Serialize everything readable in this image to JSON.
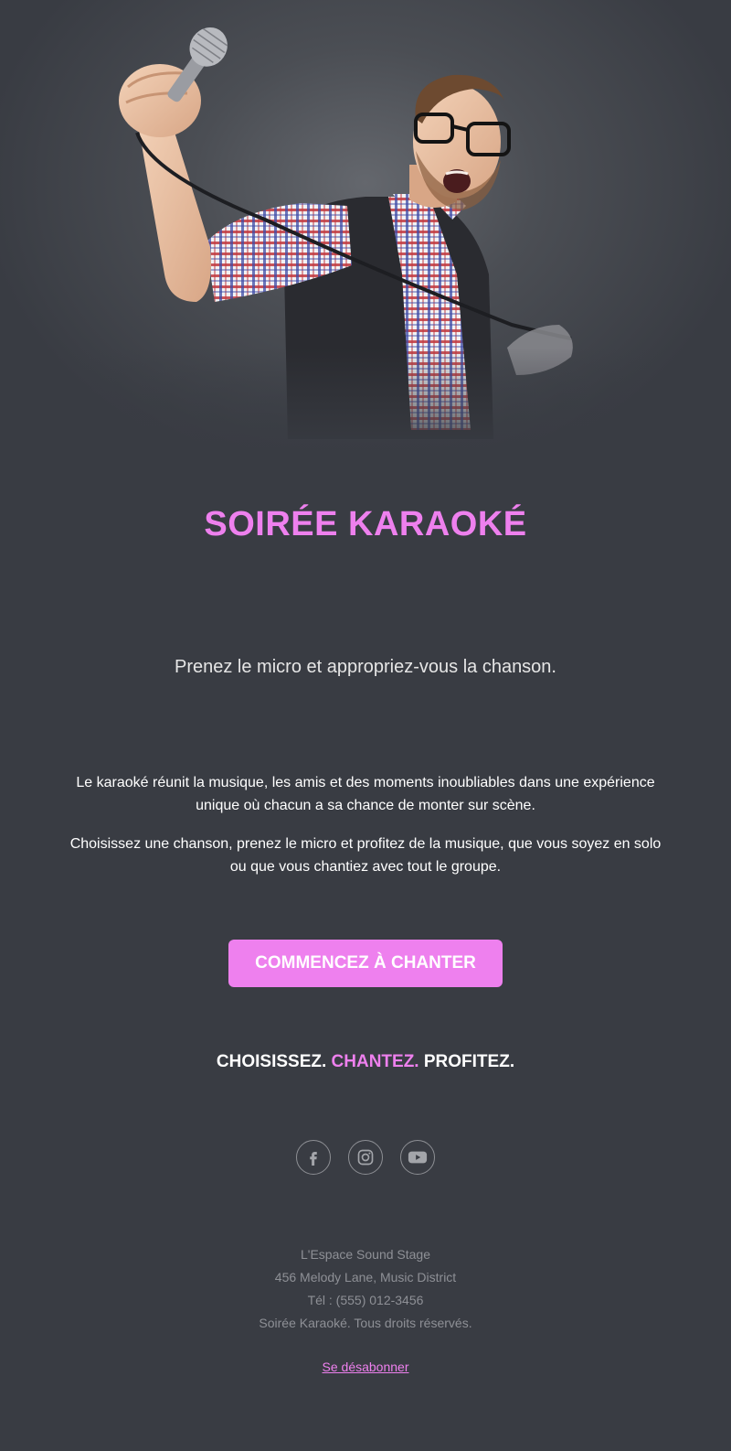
{
  "colors": {
    "background": "#393c43",
    "accent": "#ee80ee",
    "footer_text": "#8e9096"
  },
  "hero": {
    "image_description_icon": "singer-photo"
  },
  "header": {
    "title": "SOIRÉE KARAOKÉ",
    "subtitle": "Prenez le micro et appropriez-vous la chanson."
  },
  "body": {
    "paragraph_1": "Le karaoké réunit la musique, les amis et des moments inoubliables dans une expérience unique où chacun a sa chance de monter sur scène.",
    "paragraph_2": "Choisissez une chanson, prenez le micro et profitez de la musique, que vous soyez en solo ou que vous chantiez avec tout le groupe."
  },
  "cta": {
    "label": "COMMENCEZ À CHANTER"
  },
  "slogan": {
    "part_1": "CHOISISSEZ.",
    "part_2": "CHANTEZ.",
    "part_3": "PROFITEZ."
  },
  "social": [
    {
      "icon": "facebook-icon"
    },
    {
      "icon": "instagram-icon"
    },
    {
      "icon": "youtube-icon"
    }
  ],
  "footer": {
    "venue": "L'Espace Sound Stage",
    "address": "456 Melody Lane, Music District",
    "phone": "Tél : (555) 012-3456",
    "rights": "Soirée Karaoké. Tous droits réservés.",
    "unsubscribe": "Se désabonner"
  }
}
